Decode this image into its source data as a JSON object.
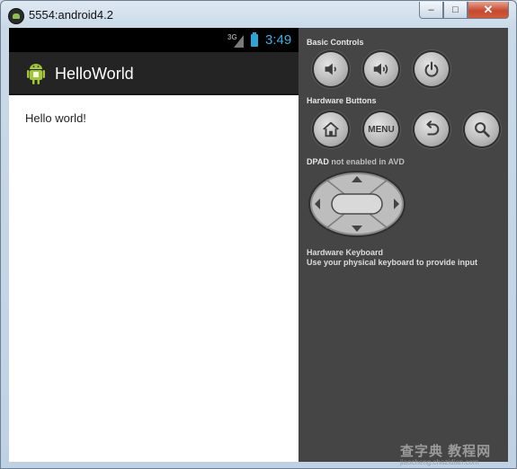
{
  "window": {
    "title": "5554:android4.2",
    "minimize_glyph": "–",
    "maximize_glyph": "□",
    "close_glyph": "✕"
  },
  "phone": {
    "status_bar": {
      "network": "3G",
      "time": "3:49"
    },
    "action_bar": {
      "app_title": "HelloWorld",
      "icon": "android-robot-icon"
    },
    "content": {
      "text": "Hello world!"
    }
  },
  "controls": {
    "basic_controls": {
      "label": "Basic Controls",
      "buttons": [
        "volume-down-icon",
        "volume-up-icon",
        "power-icon"
      ]
    },
    "hardware_buttons": {
      "label": "Hardware Buttons",
      "buttons": [
        "home-icon",
        "MENU",
        "back-icon",
        "search-icon"
      ],
      "menu_label": "MENU"
    },
    "dpad": {
      "label_strong": "DPAD",
      "label_muted": "not enabled in AVD"
    },
    "keyboard": {
      "label": "Hardware Keyboard",
      "hint": "Use your physical keyboard to provide input"
    }
  },
  "watermark": {
    "main": "查字典 教程网",
    "sub": "jiaocheng.chazidian.com"
  },
  "colors": {
    "accent": "#33b5e5",
    "panel_bg": "#454545",
    "action_bar": "#242424"
  }
}
